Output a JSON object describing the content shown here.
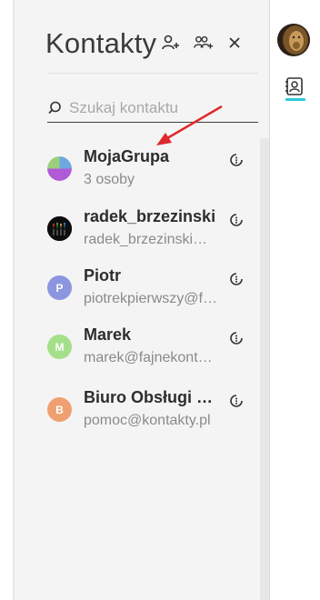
{
  "panel": {
    "title": "Kontakty",
    "add_contact_icon": "add-contact-icon",
    "add_group_icon": "add-group-icon",
    "close_icon": "close-icon"
  },
  "search": {
    "placeholder": "Szukaj kontaktu",
    "value": "",
    "icon": "search-icon"
  },
  "contacts": [
    {
      "name": "MojaGrupa",
      "sub": "3 osoby",
      "avatar_type": "group",
      "initial": ""
    },
    {
      "name": "radek_brzezinski",
      "sub": "radek_brzezinski@fajnekontakty.pl",
      "avatar_type": "photo",
      "initial": ""
    },
    {
      "name": "Piotr",
      "sub": "piotrekpierwszy@fajnekontakty.pl",
      "avatar_type": "initial",
      "initial": "P",
      "color": "#8b95e0"
    },
    {
      "name": "Marek",
      "sub": "marek@fajnekontakty.pl",
      "avatar_type": "initial",
      "initial": "M",
      "color": "#a4e08a"
    },
    {
      "name": "Biuro Obsługi Klienta",
      "sub": "pomoc@kontakty.pl",
      "avatar_type": "initial",
      "initial": "B",
      "color": "#f0a070"
    }
  ],
  "rail": {
    "user_avatar": "user-avatar",
    "contacts_icon": "contacts-book-icon",
    "accent": "#2cc9d8"
  },
  "colors": {
    "annotation_arrow": "#e0282c"
  }
}
